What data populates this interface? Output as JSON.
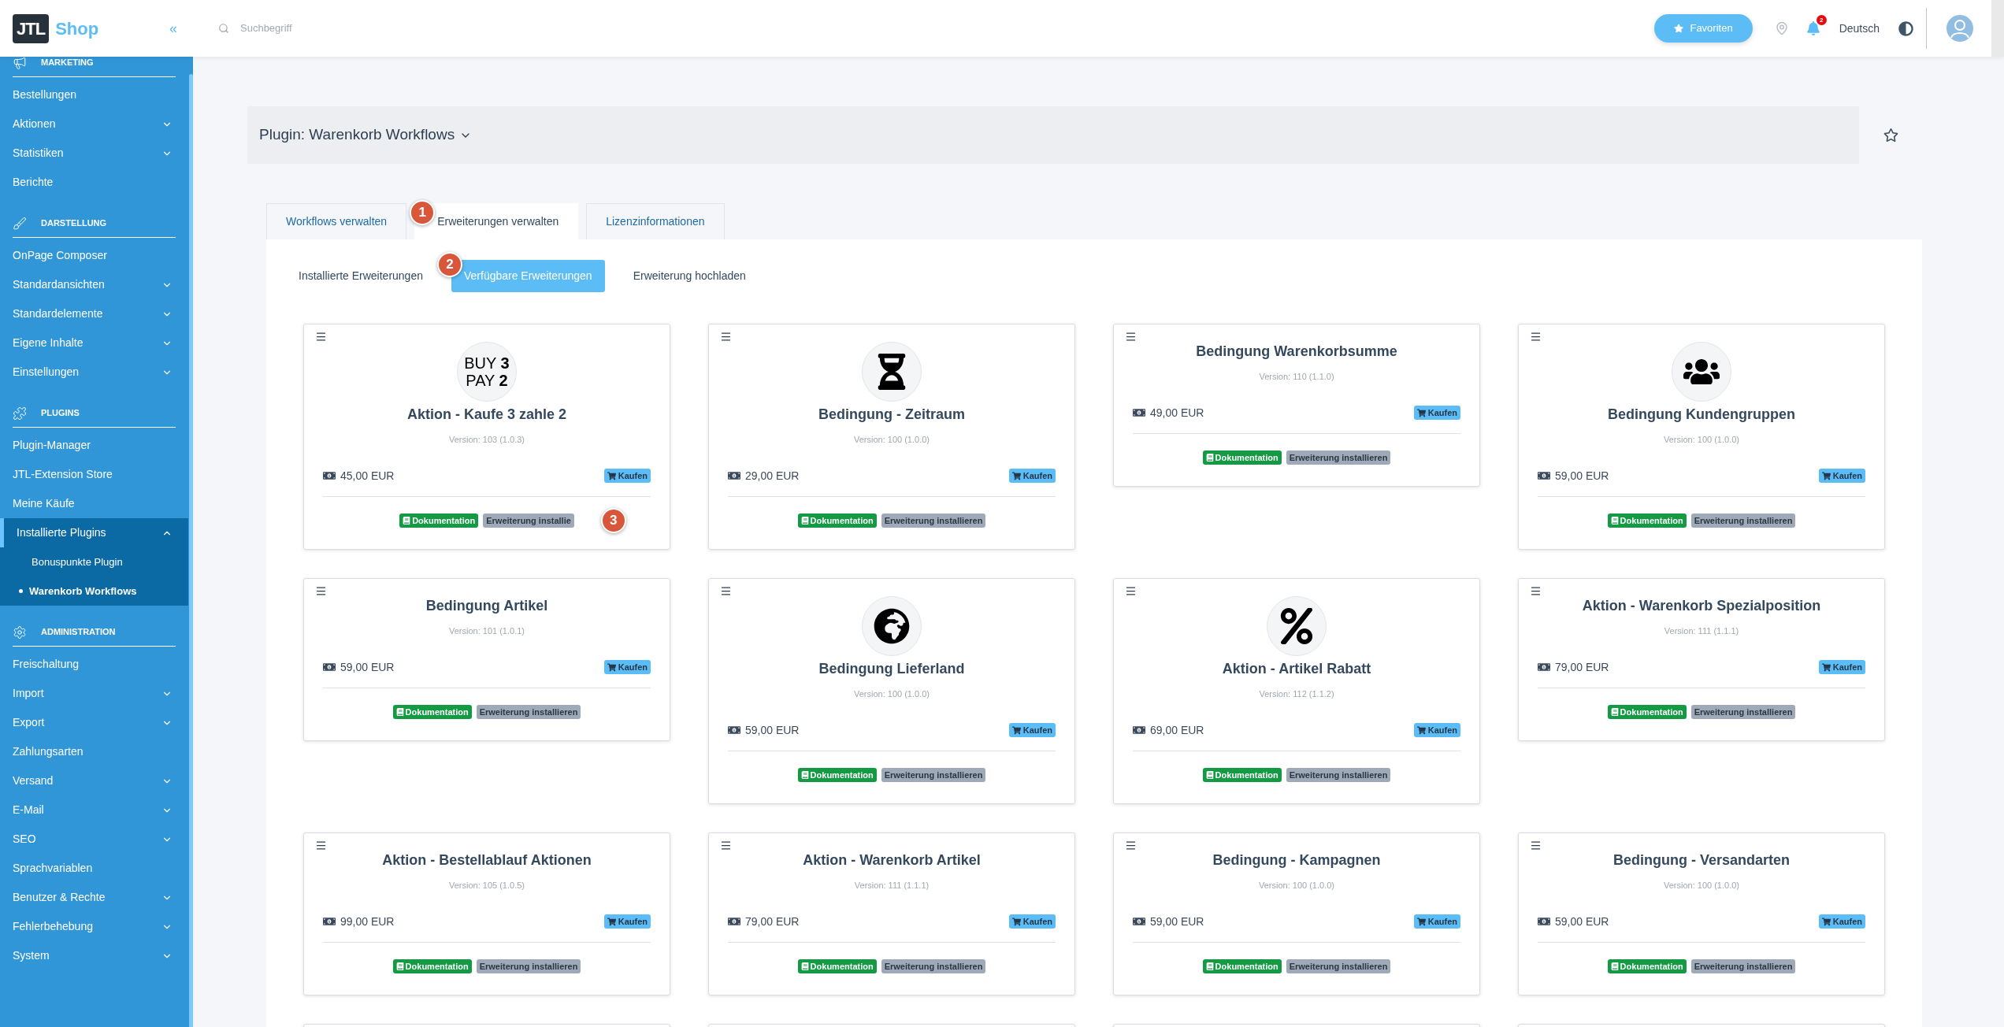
{
  "logo": {
    "mark": "JTL",
    "text": "Shop"
  },
  "collapse": "«",
  "search": {
    "placeholder": "Suchbegriff"
  },
  "header": {
    "favorites": "Favoriten",
    "notifications": "2",
    "language": "Deutsch"
  },
  "sidebar": {
    "sections": [
      {
        "title": "MARKETING",
        "items": [
          {
            "label": "Bestellungen",
            "kind": "link"
          },
          {
            "label": "Aktionen",
            "kind": "group",
            "expanded": false
          },
          {
            "label": "Statistiken",
            "kind": "group",
            "expanded": false
          },
          {
            "label": "Berichte",
            "kind": "link"
          }
        ]
      },
      {
        "title": "DARSTELLUNG",
        "items": [
          {
            "label": "OnPage Composer",
            "kind": "link"
          },
          {
            "label": "Standardansichten",
            "kind": "group",
            "expanded": false
          },
          {
            "label": "Standardelemente",
            "kind": "group",
            "expanded": false
          },
          {
            "label": "Eigene Inhalte",
            "kind": "group",
            "expanded": false
          },
          {
            "label": "Einstellungen",
            "kind": "group",
            "expanded": false
          }
        ]
      },
      {
        "title": "PLUGINS",
        "items": [
          {
            "label": "Plugin-Manager",
            "kind": "link"
          },
          {
            "label": "JTL-Extension Store",
            "kind": "link"
          },
          {
            "label": "Meine Käufe",
            "kind": "link"
          },
          {
            "label": "Installierte Plugins",
            "kind": "group",
            "expanded": true,
            "children": [
              {
                "label": "Bonuspunkte Plugin",
                "selected": false
              },
              {
                "label": "Warenkorb Workflows",
                "selected": true
              }
            ]
          }
        ]
      },
      {
        "title": "ADMINISTRATION",
        "items": [
          {
            "label": "Freischaltung",
            "kind": "link"
          },
          {
            "label": "Import",
            "kind": "group",
            "expanded": false
          },
          {
            "label": "Export",
            "kind": "group",
            "expanded": false
          },
          {
            "label": "Zahlungsarten",
            "kind": "link"
          },
          {
            "label": "Versand",
            "kind": "group",
            "expanded": false
          },
          {
            "label": "E-Mail",
            "kind": "group",
            "expanded": false
          },
          {
            "label": "SEO",
            "kind": "group",
            "expanded": false
          },
          {
            "label": "Sprachvariablen",
            "kind": "link"
          },
          {
            "label": "Benutzer & Rechte",
            "kind": "group",
            "expanded": false
          },
          {
            "label": "Fehlerbehebung",
            "kind": "group",
            "expanded": false
          },
          {
            "label": "System",
            "kind": "group",
            "expanded": false
          }
        ]
      }
    ]
  },
  "page_title": "Plugin: Warenkorb Workflows",
  "tabs": [
    {
      "label": "Workflows verwalten",
      "selected": false
    },
    {
      "label": "Erweiterungen verwalten",
      "selected": true,
      "marker": "1"
    },
    {
      "label": "Lizenzinformationen",
      "selected": false
    }
  ],
  "subtabs": [
    {
      "label": "Installierte Erweiterungen",
      "selected": false
    },
    {
      "label": "Verfügbare Erweiterungen",
      "selected": true,
      "marker": "2"
    },
    {
      "label": "Erweiterung hochladen",
      "selected": false
    }
  ],
  "cards": [
    {
      "kind": "logo",
      "logo_lines": [
        "BUY **3**",
        "PAY **2**"
      ],
      "title": "Aktion - Kaufe 3 zahle 2",
      "version": "Version: 103 (1.0.3)",
      "price": "45,00 EUR",
      "buy": "Kaufen",
      "docs": "Dokumentation",
      "install": "Erweiterung installie",
      "marker": "3"
    },
    {
      "kind": "icon",
      "title": "Bedingung - Zeitraum",
      "version": "Version: 100 (1.0.0)",
      "price": "29,00 EUR",
      "buy": "Kaufen",
      "docs": "Dokumentation",
      "install": "Erweiterung installieren"
    },
    {
      "kind": "plain",
      "title": "Bedingung Warenkorbsumme",
      "version": "Version: 110 (1.1.0)",
      "price": "49,00 EUR",
      "buy": "Kaufen",
      "docs": "Dokumentation",
      "install": "Erweiterung installieren"
    },
    {
      "kind": "icon",
      "title": "Bedingung Kundengruppen",
      "version": "Version: 100 (1.0.0)",
      "price": "59,00 EUR",
      "buy": "Kaufen",
      "docs": "Dokumentation",
      "install": "Erweiterung installieren"
    },
    {
      "kind": "plain",
      "title": "Bedingung Artikel",
      "version": "Version: 101 (1.0.1)",
      "price": "59,00 EUR",
      "buy": "Kaufen",
      "docs": "Dokumentation",
      "install": "Erweiterung installieren"
    },
    {
      "kind": "icon",
      "title": "Bedingung Lieferland",
      "version": "Version: 100 (1.0.0)",
      "price": "59,00 EUR",
      "buy": "Kaufen",
      "docs": "Dokumentation",
      "install": "Erweiterung installieren"
    },
    {
      "kind": "icon",
      "title": "Aktion - Artikel Rabatt",
      "version": "Version: 112 (1.1.2)",
      "price": "69,00 EUR",
      "buy": "Kaufen",
      "docs": "Dokumentation",
      "install": "Erweiterung installieren"
    },
    {
      "kind": "plain",
      "title": "Aktion - Warenkorb Spezialposition",
      "version": "Version: 111 (1.1.1)",
      "price": "79,00 EUR",
      "buy": "Kaufen",
      "docs": "Dokumentation",
      "install": "Erweiterung installieren"
    },
    {
      "kind": "plain",
      "title": "Aktion - Bestellablauf Aktionen",
      "version": "Version: 105 (1.0.5)",
      "price": "99,00 EUR",
      "buy": "Kaufen",
      "docs": "Dokumentation",
      "install": "Erweiterung installieren"
    },
    {
      "kind": "plain",
      "title": "Aktion - Warenkorb Artikel",
      "version": "Version: 111 (1.1.1)",
      "price": "79,00 EUR",
      "buy": "Kaufen",
      "docs": "Dokumentation",
      "install": "Erweiterung installieren"
    },
    {
      "kind": "plain",
      "title": "Bedingung - Kampagnen",
      "version": "Version: 100 (1.0.0)",
      "price": "59,00 EUR",
      "buy": "Kaufen",
      "docs": "Dokumentation",
      "install": "Erweiterung installieren"
    },
    {
      "kind": "plain",
      "title": "Bedingung - Versandarten",
      "version": "Version: 100 (1.0.0)",
      "price": "59,00 EUR",
      "buy": "Kaufen",
      "docs": "Dokumentation",
      "install": "Erweiterung installieren"
    },
    {
      "kind": "cut"
    },
    {
      "kind": "cut"
    },
    {
      "kind": "cut"
    },
    {
      "kind": "cut"
    }
  ]
}
